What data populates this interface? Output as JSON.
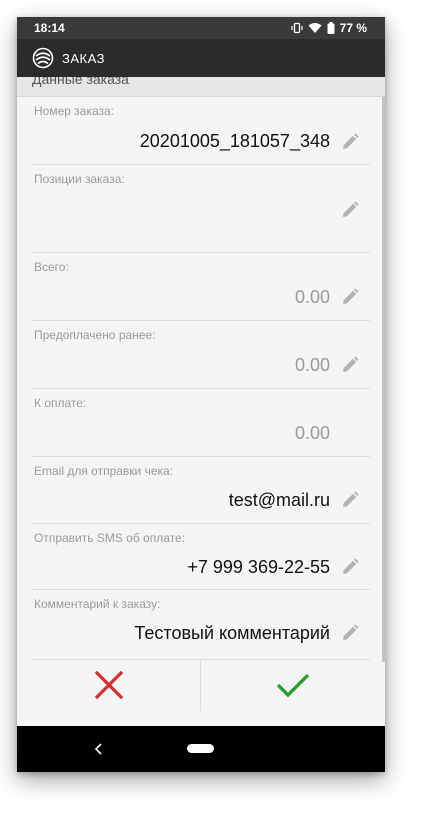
{
  "status_bar": {
    "time": "18:14",
    "battery": "77 %"
  },
  "app_bar": {
    "title": "ЗАКАЗ",
    "logo_icon": "wifi-cloud-logo-icon"
  },
  "section": {
    "title": "Данные заказа"
  },
  "fields": [
    {
      "label": "Номер заказа:",
      "value": "20201005_181057_348",
      "editable": true
    },
    {
      "label": "Позиции заказа:",
      "value": "",
      "editable": true
    },
    {
      "label": "Всего:",
      "value": "0.00",
      "editable": true
    },
    {
      "label": "Предоплачено ранее:",
      "value": "0.00",
      "editable": true
    },
    {
      "label": "К оплате:",
      "value": "0.00",
      "editable": false
    },
    {
      "label": "Email для отправки чека:",
      "value": "test@mail.ru",
      "editable": true
    },
    {
      "label": "Отправить SMS об оплате:",
      "value": "+7 999 369-22-55",
      "editable": true
    },
    {
      "label": "Комментарий к заказу:",
      "value": "Тестовый комментарий",
      "editable": true
    }
  ],
  "actions": {
    "cancel_icon": "close-icon",
    "confirm_icon": "check-icon",
    "cancel_color": "#d32f2f",
    "confirm_color": "#2e9e2e"
  },
  "nav_bar": {
    "back_icon": "back-chevron-icon",
    "home_icon": "home-pill-icon"
  }
}
